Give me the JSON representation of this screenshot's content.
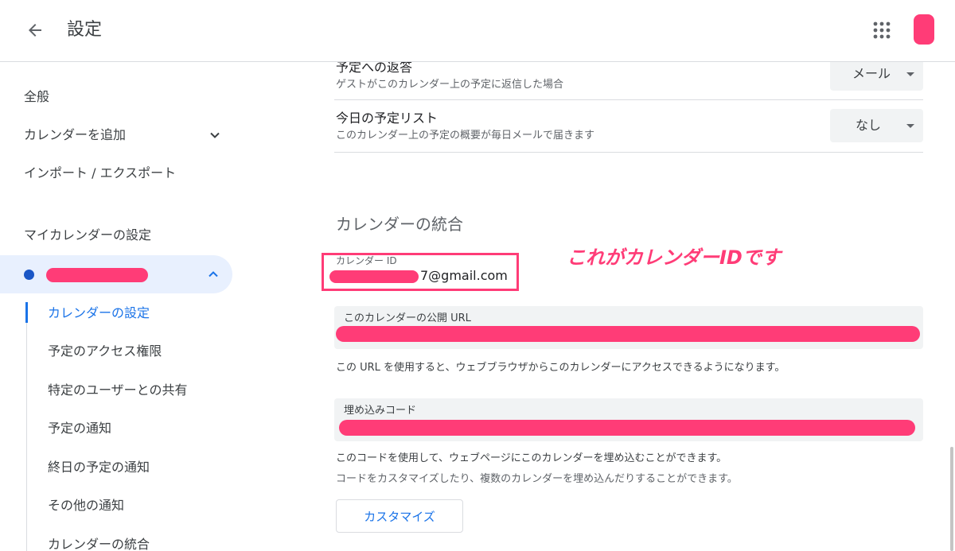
{
  "header": {
    "back_icon": "arrow-back-icon",
    "title": "設定",
    "apps_icon": "apps-grid-icon",
    "avatar_color": "#ff3c77"
  },
  "sidebar": {
    "items": [
      {
        "label": "全般"
      },
      {
        "label": "カレンダーを追加"
      },
      {
        "label": "インポート / エクスポート"
      }
    ],
    "section_title": "マイカレンダーの設定",
    "calendar": {
      "dot_color": "#1a56c6",
      "name_redacted": true,
      "sub_items": [
        {
          "label": "カレンダーの設定",
          "active": true
        },
        {
          "label": "予定のアクセス権限"
        },
        {
          "label": "特定のユーザーとの共有"
        },
        {
          "label": "予定の通知"
        },
        {
          "label": "終日の予定の通知"
        },
        {
          "label": "その他の通知"
        },
        {
          "label": "カレンダーの統合"
        }
      ]
    }
  },
  "main": {
    "settings": [
      {
        "title": "予定への返答",
        "desc": "ゲストがこのカレンダー上の予定に返信した場合",
        "value": "メール"
      },
      {
        "title": "今日の予定リスト",
        "desc": "このカレンダー上の予定の概要が毎日メールで届きます",
        "value": "なし"
      }
    ],
    "integration": {
      "title": "カレンダーの統合",
      "calendar_id_label": "カレンダー ID",
      "calendar_id_value": "7@gmail.com",
      "annotation": "これがカレンダーIDです",
      "public_url_label": "このカレンダーの公開 URL",
      "public_url_help": "この URL を使用すると、ウェブブラウザからこのカレンダーにアクセスできるようになります。",
      "embed_label": "埋め込みコード",
      "embed_help1": "このコードを使用して、ウェブページにこのカレンダーを埋め込むことができます。",
      "embed_help2": "コードをカスタマイズしたり、複数のカレンダーを埋め込んだりすることができます。",
      "customize_button": "カスタマイズ"
    }
  },
  "colors": {
    "accent": "#1a73e8",
    "redaction": "#ff3c77",
    "active_bg": "#e8f0fe"
  }
}
